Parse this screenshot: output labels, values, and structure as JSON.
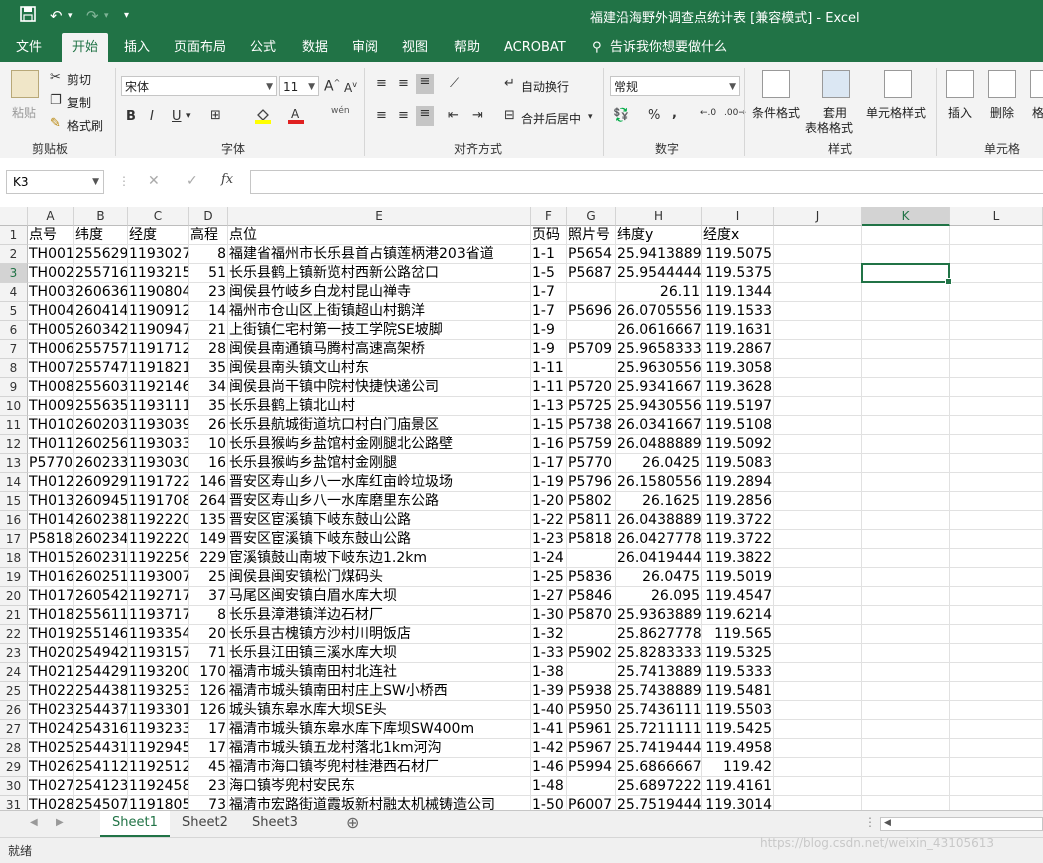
{
  "window": {
    "title": "福建沿海野外调查点统计表  [兼容模式]  -  Excel",
    "save_icon": "save-icon",
    "undo_icon": "undo-icon",
    "redo_icon": "redo-icon"
  },
  "menu": {
    "tabs": [
      "文件",
      "开始",
      "插入",
      "页面布局",
      "公式",
      "数据",
      "审阅",
      "视图",
      "帮助",
      "ACROBAT"
    ],
    "active": "开始",
    "tell_me": "告诉我你想要做什么"
  },
  "ribbon": {
    "clipboard": {
      "paste": "粘贴",
      "cut": "剪切",
      "copy": "复制",
      "format_painter": "格式刷",
      "label": "剪贴板"
    },
    "font": {
      "name": "宋体",
      "size": "11",
      "bold": "B",
      "italic": "I",
      "underline": "U",
      "label": "字体",
      "phonetic": "wén"
    },
    "alignment": {
      "wrap": "自动换行",
      "merge": "合并后居中",
      "label": "对齐方式"
    },
    "number": {
      "format": "常规",
      "label": "数字",
      "percent": "%",
      "comma": ","
    },
    "styles": {
      "conditional": "条件格式",
      "table_top": "套用",
      "table_bottom": "表格格式",
      "cell_styles": "单元格样式",
      "label": "样式"
    },
    "cells": {
      "insert": "插入",
      "delete": "删除",
      "format_partial": "格",
      "label": "单元格"
    }
  },
  "formula_bar": {
    "name_box": "K3",
    "cancel": "✕",
    "enter": "✓",
    "fx": "fx",
    "value": ""
  },
  "grid": {
    "columns": [
      "A",
      "B",
      "C",
      "D",
      "E",
      "F",
      "G",
      "H",
      "I",
      "J",
      "K",
      "L"
    ],
    "selected_column": "K",
    "selected_row": "3",
    "rows": [
      {
        "n": "1",
        "A": "点号",
        "B": "纬度",
        "C": "经度",
        "D": "高程",
        "E": "点位",
        "F": "页码",
        "G": "照片号",
        "H": "纬度y",
        "I": "经度x"
      },
      {
        "n": "2",
        "A": "TH001",
        "B": "255629",
        "C": "1193027",
        "D": "8",
        "E": "福建省福州市长乐县首占镇莲柄港203省道",
        "F": "1-1",
        "G": "P5654",
        "H": "25.9413889",
        "I": "119.5075"
      },
      {
        "n": "3",
        "A": "TH002",
        "B": "255716",
        "C": "1193215",
        "D": "51",
        "E": "长乐县鹤上镇新览村西新公路岔口",
        "F": "1-5",
        "G": "P5687",
        "H": "25.9544444",
        "I": "119.5375"
      },
      {
        "n": "4",
        "A": "TH003",
        "B": "260636",
        "C": "1190804",
        "D": "23",
        "E": "闽侯县竹岐乡白龙村昆山禅寺",
        "F": "1-7",
        "G": "",
        "H": "26.11",
        "I": "119.1344"
      },
      {
        "n": "5",
        "A": "TH004",
        "B": "260414",
        "C": "1190912",
        "D": "14",
        "E": "福州市仓山区上街镇超山村鹅洋",
        "F": "1-7",
        "G": "P5696",
        "H": "26.0705556",
        "I": "119.1533"
      },
      {
        "n": "6",
        "A": "TH005",
        "B": "260342",
        "C": "1190947",
        "D": "21",
        "E": "上街镇仁宅村第一技工学院SE坡脚",
        "F": "1-9",
        "G": "",
        "H": "26.0616667",
        "I": "119.1631"
      },
      {
        "n": "7",
        "A": "TH006",
        "B": "255757",
        "C": "1191712",
        "D": "28",
        "E": "闽侯县南通镇马腾村高速高架桥",
        "F": "1-9",
        "G": "P5709",
        "H": "25.9658333",
        "I": "119.2867"
      },
      {
        "n": "8",
        "A": "TH007",
        "B": "255747",
        "C": "1191821",
        "D": "35",
        "E": "闽侯县南头镇文山村东",
        "F": "1-11",
        "G": "",
        "H": "25.9630556",
        "I": "119.3058"
      },
      {
        "n": "9",
        "A": "TH008",
        "B": "255603",
        "C": "1192146",
        "D": "34",
        "E": "闽侯县尚干镇中院村快捷快递公司",
        "F": "1-11",
        "G": "P5720",
        "H": "25.9341667",
        "I": "119.3628"
      },
      {
        "n": "10",
        "A": "TH009",
        "B": "255635",
        "C": "1193111",
        "D": "35",
        "E": "长乐县鹤上镇北山村",
        "F": "1-13",
        "G": "P5725",
        "H": "25.9430556",
        "I": "119.5197"
      },
      {
        "n": "11",
        "A": "TH010",
        "B": "260203",
        "C": "1193039",
        "D": "26",
        "E": "长乐县航城街道坑口村白门庙景区",
        "F": "1-15",
        "G": "P5738",
        "H": "26.0341667",
        "I": "119.5108"
      },
      {
        "n": "12",
        "A": "TH011",
        "B": "260256",
        "C": "1193033",
        "D": "10",
        "E": "长乐县猴屿乡盐馆村金刚腿北公路壁",
        "F": "1-16",
        "G": "P5759",
        "H": "26.0488889",
        "I": "119.5092"
      },
      {
        "n": "13",
        "A": "P5770",
        "B": "260233",
        "C": "1193030",
        "D": "16",
        "E": "长乐县猴屿乡盐馆村金刚腿",
        "F": "1-17",
        "G": "P5770",
        "H": "26.0425",
        "I": "119.5083"
      },
      {
        "n": "14",
        "A": "TH012",
        "B": "260929",
        "C": "1191722",
        "D": "146",
        "E": "晋安区寿山乡八一水库红亩岭垃圾场",
        "F": "1-19",
        "G": "P5796",
        "H": "26.1580556",
        "I": "119.2894"
      },
      {
        "n": "15",
        "A": "TH013",
        "B": "260945",
        "C": "1191708",
        "D": "264",
        "E": "晋安区寿山乡八一水库磨里东公路",
        "F": "1-20",
        "G": "P5802",
        "H": "26.1625",
        "I": "119.2856"
      },
      {
        "n": "16",
        "A": "TH014",
        "B": "260238",
        "C": "1192220",
        "D": "135",
        "E": "晋安区宦溪镇下岐东鼓山公路",
        "F": "1-22",
        "G": "P5811",
        "H": "26.0438889",
        "I": "119.3722"
      },
      {
        "n": "17",
        "A": "P5818",
        "B": "260234",
        "C": "1192220",
        "D": "149",
        "E": "晋安区宦溪镇下岐东鼓山公路",
        "F": "1-23",
        "G": "P5818",
        "H": "26.0427778",
        "I": "119.3722"
      },
      {
        "n": "18",
        "A": "TH015",
        "B": "260231",
        "C": "1192256",
        "D": "229",
        "E": "宦溪镇鼓山南坡下岐东边1.2km",
        "F": "1-24",
        "G": "",
        "H": "26.0419444",
        "I": "119.3822"
      },
      {
        "n": "19",
        "A": "TH016",
        "B": "260251",
        "C": "1193007",
        "D": "25",
        "E": "闽侯县闽安镇松门煤码头",
        "F": "1-25",
        "G": "P5836",
        "H": "26.0475",
        "I": "119.5019"
      },
      {
        "n": "20",
        "A": "TH017",
        "B": "260542",
        "C": "1192717",
        "D": "37",
        "E": "马尾区闽安镇白眉水库大坝",
        "F": "1-27",
        "G": "P5846",
        "H": "26.095",
        "I": "119.4547"
      },
      {
        "n": "21",
        "A": "TH018",
        "B": "255611",
        "C": "1193717",
        "D": "8",
        "E": "长乐县漳港镇洋边石材厂",
        "F": "1-30",
        "G": "P5870",
        "H": "25.9363889",
        "I": "119.6214"
      },
      {
        "n": "22",
        "A": "TH019",
        "B": "255146",
        "C": "1193354",
        "D": "20",
        "E": "长乐县古槐镇方沙村川明饭店",
        "F": "1-32",
        "G": "",
        "H": "25.8627778",
        "I": "119.565"
      },
      {
        "n": "23",
        "A": "TH020",
        "B": "254942",
        "C": "1193157",
        "D": "71",
        "E": "长乐县江田镇三溪水库大坝",
        "F": "1-33",
        "G": "P5902",
        "H": "25.8283333",
        "I": "119.5325"
      },
      {
        "n": "24",
        "A": "TH021",
        "B": "254429",
        "C": "1193200",
        "D": "170",
        "E": "福清市城头镇南田村北连社",
        "F": "1-38",
        "G": "",
        "H": "25.7413889",
        "I": "119.5333"
      },
      {
        "n": "25",
        "A": "TH022",
        "B": "254438",
        "C": "1193253",
        "D": "126",
        "E": "福清市城头镇南田村庄上SW小桥西",
        "F": "1-39",
        "G": "P5938",
        "H": "25.7438889",
        "I": "119.5481"
      },
      {
        "n": "26",
        "A": "TH023",
        "B": "254437",
        "C": "1193301",
        "D": "126",
        "E": "城头镇东皋水库大坝SE头",
        "F": "1-40",
        "G": "P5950",
        "H": "25.7436111",
        "I": "119.5503"
      },
      {
        "n": "27",
        "A": "TH024",
        "B": "254316",
        "C": "1193233",
        "D": "17",
        "E": "福清市城头镇东皋水库下库坝SW400m",
        "F": "1-41",
        "G": "P5961",
        "H": "25.7211111",
        "I": "119.5425"
      },
      {
        "n": "28",
        "A": "TH025",
        "B": "254431",
        "C": "1192945",
        "D": "17",
        "E": "福清市城头镇五龙村落北1km河沟",
        "F": "1-42",
        "G": "P5967",
        "H": "25.7419444",
        "I": "119.4958"
      },
      {
        "n": "29",
        "A": "TH026",
        "B": "254112",
        "C": "1192512",
        "D": "45",
        "E": "福清市海口镇岑兜村桂港西石材厂",
        "F": "1-46",
        "G": "P5994",
        "H": "25.6866667",
        "I": "119.42"
      },
      {
        "n": "30",
        "A": "TH027",
        "B": "254123",
        "C": "1192458",
        "D": "23",
        "E": "海口镇岑兜村安民东",
        "F": "1-48",
        "G": "",
        "H": "25.6897222",
        "I": "119.4161"
      },
      {
        "n": "31",
        "A": "TH028",
        "B": "254507",
        "C": "1191805",
        "D": "73",
        "E": "福清市宏路街道霞坂新村融太机械铸造公司",
        "F": "1-50",
        "G": "P6007",
        "H": "25.7519444",
        "I": "119.3014"
      }
    ]
  },
  "sheets": {
    "tabs": [
      "Sheet1",
      "Sheet2",
      "Sheet3"
    ],
    "active": "Sheet1",
    "add_icon": "add-sheet-icon"
  },
  "status": {
    "text": "就绪",
    "watermark": "https://blog.csdn.net/weixin_43105613"
  }
}
